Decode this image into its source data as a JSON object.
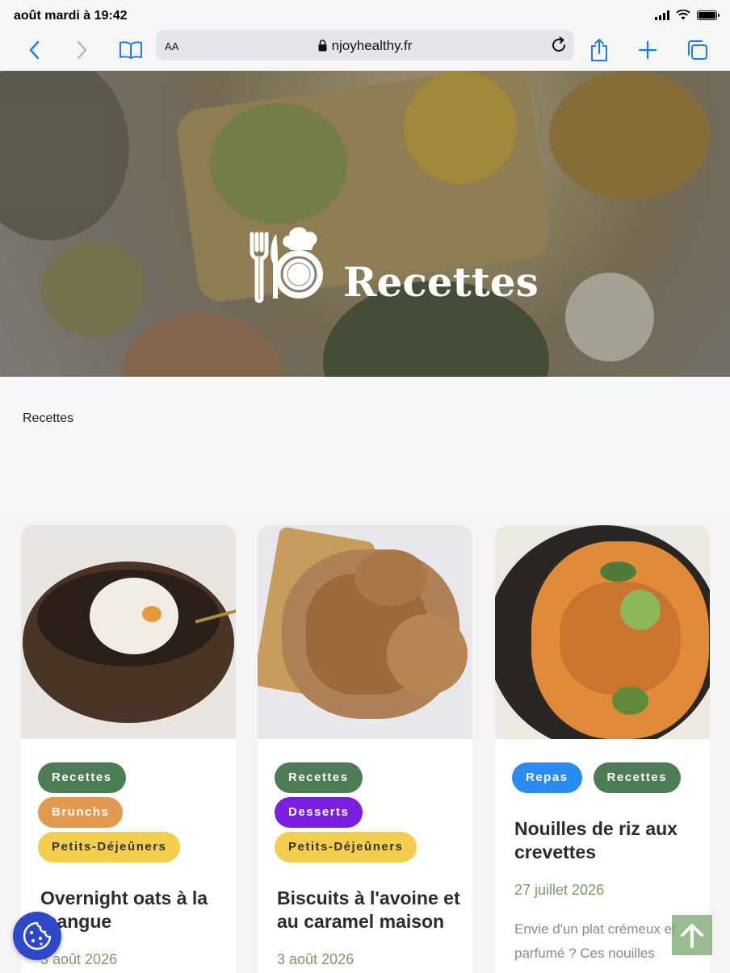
{
  "status_bar": {
    "time": "août mardi à 19:42"
  },
  "browser": {
    "reader_label": "AA",
    "url": "njoyhealthy.fr"
  },
  "hero": {
    "title": "Recettes"
  },
  "breadcrumb": "Recettes",
  "cards": [
    {
      "tags": [
        {
          "label": "Recettes",
          "color": "#4c7d55"
        },
        {
          "label": "Brunchs",
          "color": "#e39a50"
        },
        {
          "label": "Petits-Déjeûners",
          "color": "#f3cd4e"
        }
      ],
      "title": "Overnight oats à la mangue",
      "date": "3 août 2026"
    },
    {
      "tags": [
        {
          "label": "Recettes",
          "color": "#4c7d55"
        },
        {
          "label": "Desserts",
          "color": "#7a1ee0"
        },
        {
          "label": "Petits-Déjeûners",
          "color": "#f3cd4e"
        }
      ],
      "title": "Biscuits à l'avoine et au caramel maison",
      "date": "3 août 2026"
    },
    {
      "tags": [
        {
          "label": "Repas",
          "color": "#2a8cf0"
        },
        {
          "label": "Recettes",
          "color": "#4c7d55"
        }
      ],
      "title": "Nouilles de riz aux crevettes",
      "date": "27 juillet 2026",
      "excerpt": "Envie d'un plat crémeux et parfumé ? Ces nouilles"
    }
  ],
  "icons": {
    "back": "chevron-left-icon",
    "forward": "chevron-right-icon",
    "bookmarks": "book-icon",
    "lock": "lock-icon",
    "reload": "reload-icon",
    "share": "share-icon",
    "new_tab": "plus-icon",
    "tabs": "tabs-icon",
    "cookie": "cookie-icon",
    "scroll_top": "arrow-up-icon"
  }
}
